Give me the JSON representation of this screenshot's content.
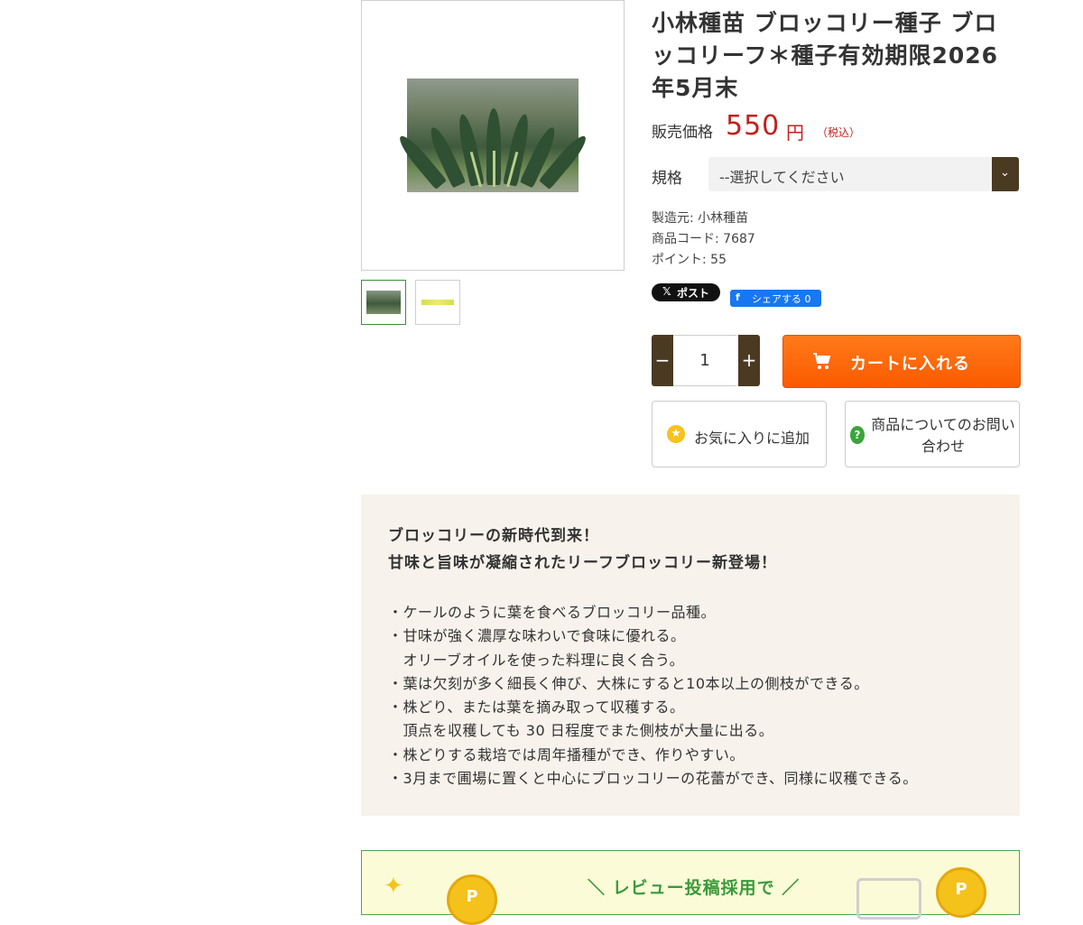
{
  "product": {
    "title": "小林種苗 ブロッコリー種子 ブロッコリーフ＊種子有効期限2026年5月末",
    "price_label": "販売価格",
    "price_value": "550",
    "price_unit": "円",
    "price_tax": "（税込）",
    "spec_label": "規格",
    "spec_selected": "--選択してください",
    "maker": "製造元: 小林種苗",
    "code": "商品コード: 7687",
    "points": "ポイント: 55"
  },
  "share": {
    "x_label": "ポスト",
    "fb_label": "シェアする 0"
  },
  "cart": {
    "quantity": "1",
    "minus": "−",
    "plus": "+",
    "add_label": "カートに入れる"
  },
  "actions": {
    "favorite_label": "お気に入りに追加",
    "inquiry_label": "商品についてのお問い合わせ"
  },
  "description": {
    "headline1": "ブロッコリーの新時代到来！",
    "headline2": "甘味と旨味が凝縮されたリーフブロッコリー新登場！",
    "lines": [
      "・ケールのように葉を食べるブロッコリー品種。",
      "・甘味が強く濃厚な味わいで食味に優れる。",
      "　オリーブオイルを使った料理に良く合う。",
      "・葉は欠刻が多く細長く伸び、大株にすると10本以上の側枝ができる。",
      "・株どり、または葉を摘み取って収穫する。",
      "　頂点を収穫しても 30 日程度でまた側枝が大量に出る。",
      "・株どりする栽培では周年播種ができ、作りやすい。",
      "・3月まで圃場に置くと中心にブロッコリーの花蕾ができ、同様に収穫できる。"
    ]
  },
  "banner": {
    "text": "＼ レビュー投稿採用で ／",
    "coin_label": "P"
  },
  "icons": {
    "cart": "cart-icon",
    "favorite": "star-icon",
    "inquiry": "question-icon",
    "select": "chevron-down-icon"
  },
  "colors": {
    "price": "#c3201c",
    "cart_button": "#fb5a00",
    "dark_brown": "#4a3a22",
    "description_bg": "#f7f2eb",
    "banner_green": "#3b9a3b"
  }
}
